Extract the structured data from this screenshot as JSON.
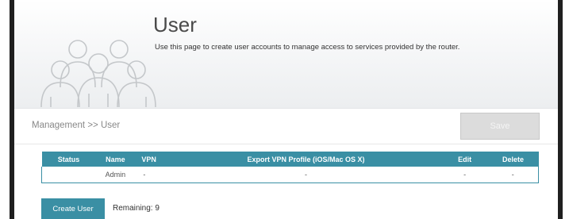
{
  "header": {
    "title": "User",
    "description": "Use this page to create user accounts to manage access to services provided by the router.",
    "icon": "users-group-icon"
  },
  "breadcrumb": "Management >> User",
  "toolbar": {
    "save_label": "Save"
  },
  "table": {
    "columns": [
      "Status",
      "Name",
      "VPN",
      "Export VPN Profile (iOS/Mac OS X)",
      "Edit",
      "Delete"
    ],
    "rows": [
      {
        "status": "",
        "name": "Admin",
        "vpn": "-",
        "export": "-",
        "edit": "-",
        "delete": "-"
      }
    ]
  },
  "actions": {
    "create_user_label": "Create User",
    "remaining": "Remaining: 9"
  },
  "colors": {
    "accent": "#3a8fa4",
    "save_disabled": "#dcdcdc"
  }
}
